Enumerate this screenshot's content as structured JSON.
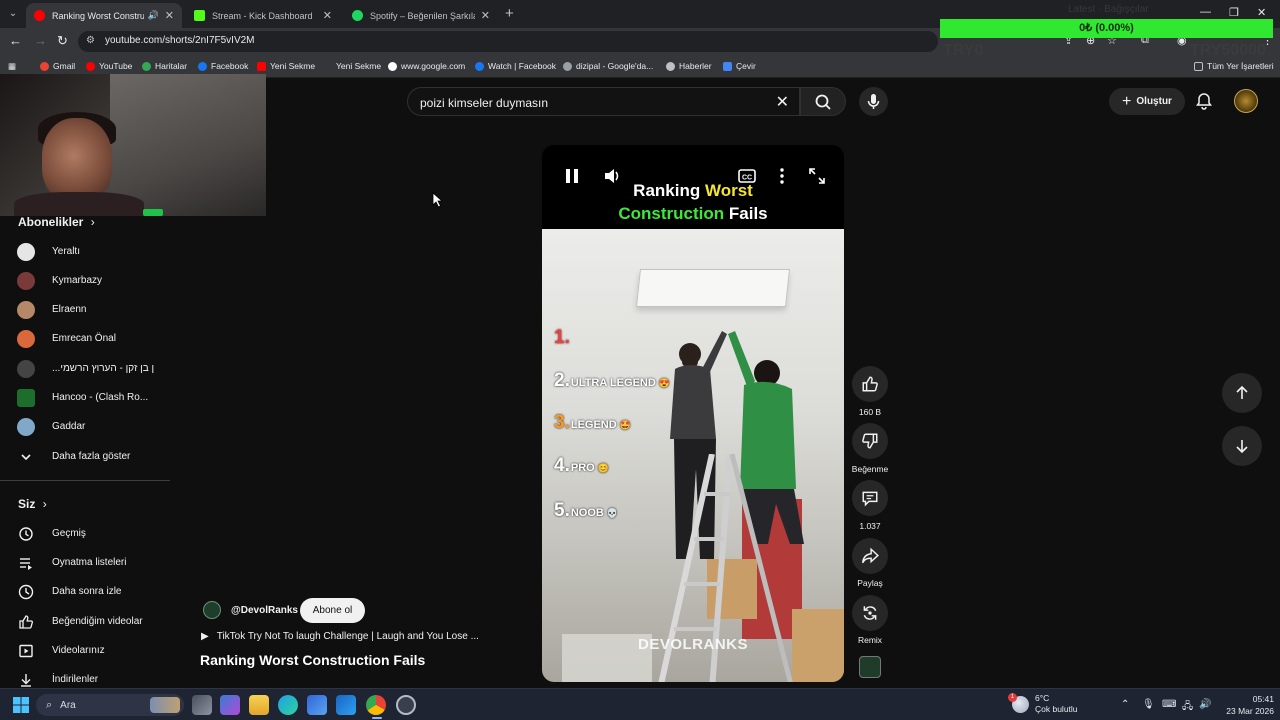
{
  "browser": {
    "tabs": [
      {
        "label": "Ranking Worst Construction Fails",
        "active": true,
        "favicon_color": "#ff0000"
      },
      {
        "label": "Stream - Kick Dashboard",
        "active": false,
        "favicon_color": "#53fc18"
      },
      {
        "label": "Spotify – Beğenilen Şarkılar",
        "active": false,
        "favicon_color": "#1ed760"
      }
    ],
    "url": "youtube.com/shorts/2nI7F5vIV2M",
    "bookmarks": [
      {
        "label": "Gmail",
        "icon_color": "#ea4335"
      },
      {
        "label": "YouTube",
        "icon_color": "#ff0000"
      },
      {
        "label": "Haritalar",
        "icon_color": "#34a853"
      },
      {
        "label": "Facebook",
        "icon_color": "#1877f2"
      },
      {
        "label": "Yeni Sekme",
        "icon_color": "#ff0000"
      },
      {
        "label": "Yeni Sekme",
        "icon_color": "#9aa0a6"
      },
      {
        "label": "www.google.com",
        "icon_color": "#ffffff"
      },
      {
        "label": "Watch | Facebook",
        "icon_color": "#1877f2"
      },
      {
        "label": "dizipal - Google'da...",
        "icon_color": "#9aa0a6"
      },
      {
        "label": "Haberler",
        "icon_color": "#bdc1c6"
      },
      {
        "label": "Çevir",
        "icon_color": "#4285f4"
      }
    ],
    "all_bookmarks_label": "Tüm Yer İşaretleri"
  },
  "stream_overlay": {
    "donation_text": "0₺ (0.00%)",
    "donation_color": "#30e830",
    "faint_left": "TRY0",
    "faint_right": "TRY50000",
    "faint_top": "Latest · Bağışçılar"
  },
  "youtube": {
    "search_query": "poizi kimseler duymasın",
    "create_label": "Oluştur",
    "sidebar": {
      "subs_heading": "Abonelikler",
      "subscriptions": [
        {
          "name": "Yeraltı",
          "color": "#e5e5e5"
        },
        {
          "name": "Kymarbazy",
          "color": "#7a3a3a"
        },
        {
          "name": "Elraenn",
          "color": "#b58868"
        },
        {
          "name": "Emrecan Önal",
          "color": "#d9683a"
        },
        {
          "name": "...ן בן זקן - הערוץ הרשמי",
          "color": "#444"
        },
        {
          "name": "Hancoo - (Clash Ro...",
          "color": "#1d6e2c"
        },
        {
          "name": "Gaddar",
          "color": "#7fa8c9"
        }
      ],
      "show_more": "Daha fazla göster",
      "you_heading": "Siz",
      "you_items": [
        {
          "label": "Geçmiş",
          "icon": "history-icon"
        },
        {
          "label": "Oynatma listeleri",
          "icon": "playlist-icon"
        },
        {
          "label": "Daha sonra izle",
          "icon": "watch-later-icon"
        },
        {
          "label": "Beğendiğim videolar",
          "icon": "like-icon"
        },
        {
          "label": "Videolarınız",
          "icon": "your-videos-icon"
        },
        {
          "label": "İndirilenler",
          "icon": "download-icon"
        }
      ]
    },
    "short": {
      "video_title_line1_a": "Ranking ",
      "video_title_line1_b": "Worst",
      "video_title_line2_a": "Construction",
      "video_title_line2_b": " Fails",
      "accent_yellow": "#f6e532",
      "accent_green": "#3ee83a",
      "ranks": [
        {
          "num": "1.",
          "label": "",
          "emoji": "",
          "color": "#ff3a3a"
        },
        {
          "num": "2.",
          "label": "ULTRA LEGEND",
          "emoji": "😍",
          "color": "#ffffff"
        },
        {
          "num": "3.",
          "label": "LEGEND",
          "emoji": "🤩",
          "color": "#ff9a1f"
        },
        {
          "num": "4.",
          "label": "PRO",
          "emoji": "😊",
          "color": "#ffffff"
        },
        {
          "num": "5.",
          "label": "NOOB",
          "emoji": "💀",
          "color": "#ffffff"
        }
      ],
      "watermark": "DEVOLRANKS",
      "channel": "@DevolRanks",
      "subscribe_label": "Abone ol",
      "related_label": "TikTok Try Not To laugh Challenge | Laugh and You Lose ...",
      "title": "Ranking Worst Construction Fails",
      "actions": {
        "like_count": "160 B",
        "dislike_label": "Beğenme",
        "comment_count": "1.037",
        "share_label": "Paylaş",
        "remix_label": "Remix"
      }
    }
  },
  "taskbar": {
    "search_label": "Ara",
    "weather_temp": "6°C",
    "weather_desc": "Çok bulutlu",
    "weather_badge": "1",
    "time": "05:41",
    "date": "23 Mar 2026"
  }
}
